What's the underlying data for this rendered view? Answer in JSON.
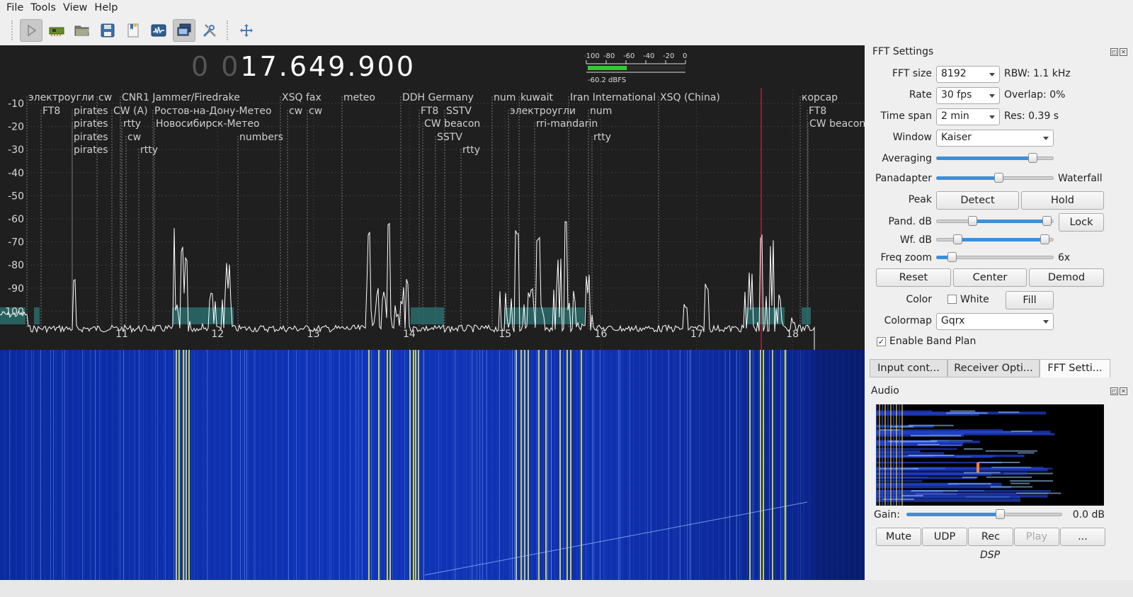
{
  "menu": {
    "file": "File",
    "tools": "Tools",
    "view": "View",
    "help": "Help"
  },
  "toolbar": {
    "icons": [
      "play-icon",
      "sdr-device-icon",
      "open-folder-icon",
      "save-icon",
      "bookmark-icon",
      "spectrum-icon",
      "remote-control-icon",
      "settings-tools-icon",
      "full-screen-icon"
    ]
  },
  "frequency": {
    "dim_digits": "0 0",
    "value": "17.649.900"
  },
  "meter": {
    "ticks": [
      "-100",
      "-80",
      "-60",
      "-40",
      "-20",
      "0"
    ],
    "reading": "-60.2 dBFS",
    "level": 0.4
  },
  "spectrum": {
    "db_labels": [
      "-10",
      "-20",
      "-30",
      "-40",
      "-50",
      "-60",
      "-70",
      "-80",
      "-90",
      "-100"
    ],
    "freq_labels": [
      "11",
      "12",
      "13",
      "14",
      "15",
      "16",
      "17",
      "18"
    ],
    "bookmarks": [
      {
        "text": "электроугли",
        "row": 0,
        "col": 40
      },
      {
        "text": "cw",
        "row": 0,
        "col": 139
      },
      {
        "text": "CNR1 Jammer/Firedrake",
        "row": 0,
        "col": 172
      },
      {
        "text": "XSQ fax",
        "row": 0,
        "col": 398
      },
      {
        "text": "meteo",
        "row": 0,
        "col": 485
      },
      {
        "text": "DDH Germany",
        "row": 0,
        "col": 568
      },
      {
        "text": "num",
        "row": 0,
        "col": 697
      },
      {
        "text": "kuwait",
        "row": 0,
        "col": 735
      },
      {
        "text": "Iran International",
        "row": 0,
        "col": 805
      },
      {
        "text": "XSQ (China)",
        "row": 0,
        "col": 932
      },
      {
        "text": "корсар",
        "row": 0,
        "col": 1132
      },
      {
        "text": "FT8",
        "row": 1,
        "col": 60
      },
      {
        "text": "pirates",
        "row": 1,
        "col": 104
      },
      {
        "text": "CW (A)",
        "row": 1,
        "col": 160
      },
      {
        "text": "Ростов-на-Дону-Метео",
        "row": 1,
        "col": 218
      },
      {
        "text": "cw",
        "row": 1,
        "col": 408
      },
      {
        "text": "cw",
        "row": 1,
        "col": 436
      },
      {
        "text": "FT8",
        "row": 1,
        "col": 594
      },
      {
        "text": "SSTV",
        "row": 1,
        "col": 630
      },
      {
        "text": "электроугли",
        "row": 1,
        "col": 720
      },
      {
        "text": "num",
        "row": 1,
        "col": 833
      },
      {
        "text": "FT8",
        "row": 1,
        "col": 1142
      },
      {
        "text": "pirates",
        "row": 2,
        "col": 104
      },
      {
        "text": "rtty",
        "row": 2,
        "col": 174
      },
      {
        "text": "Новосибирск-Метео",
        "row": 2,
        "col": 220
      },
      {
        "text": "CW beacon",
        "row": 2,
        "col": 599
      },
      {
        "text": "rri-mandarin",
        "row": 2,
        "col": 757
      },
      {
        "text": "CW beacon",
        "row": 2,
        "col": 1143
      },
      {
        "text": "pirates",
        "row": 3,
        "col": 104
      },
      {
        "text": "cw",
        "row": 3,
        "col": 180
      },
      {
        "text": "numbers",
        "row": 3,
        "col": 338
      },
      {
        "text": "SSTV",
        "row": 3,
        "col": 617
      },
      {
        "text": "rtty",
        "row": 3,
        "col": 838
      },
      {
        "text": "pirates",
        "row": 4,
        "col": 104
      },
      {
        "text": "rtty",
        "row": 4,
        "col": 198
      },
      {
        "text": "rtty",
        "row": 4,
        "col": 653
      }
    ]
  },
  "fft_settings": {
    "title": "FFT Settings",
    "fft_size_label": "FFT size",
    "fft_size_value": "8192",
    "rbw": "RBW: 1.1 kHz",
    "rate_label": "Rate",
    "rate_value": "30 fps",
    "overlap": "Overlap: 0%",
    "time_span_label": "Time span",
    "time_span_value": "2 min",
    "res": "Res: 0.39 s",
    "window_label": "Window",
    "window_value": "Kaiser",
    "averaging_label": "Averaging",
    "panadapter_label": "Panadapter",
    "waterfall_label": "Waterfall",
    "peak_label": "Peak",
    "detect": "Detect",
    "hold": "Hold",
    "pand_db_label": "Pand. dB",
    "lock": "Lock",
    "wf_db_label": "Wf. dB",
    "freq_zoom_label": "Freq zoom",
    "freq_zoom_value": "6x",
    "reset": "Reset",
    "center": "Center",
    "demod": "Demod",
    "color_label": "Color",
    "white_label": "White",
    "fill": "Fill",
    "colormap_label": "Colormap",
    "colormap_value": "Gqrx",
    "enable_band_plan": "Enable Band Plan"
  },
  "dock_tabs": [
    "Input cont...",
    "Receiver Opti...",
    "FFT Setti..."
  ],
  "audio": {
    "title": "Audio",
    "gain_label": "Gain:",
    "gain_value": "0.0 dB",
    "mute": "Mute",
    "udp": "UDP",
    "rec": "Rec",
    "play": "Play",
    "more": "...",
    "dsp": "DSP"
  }
}
